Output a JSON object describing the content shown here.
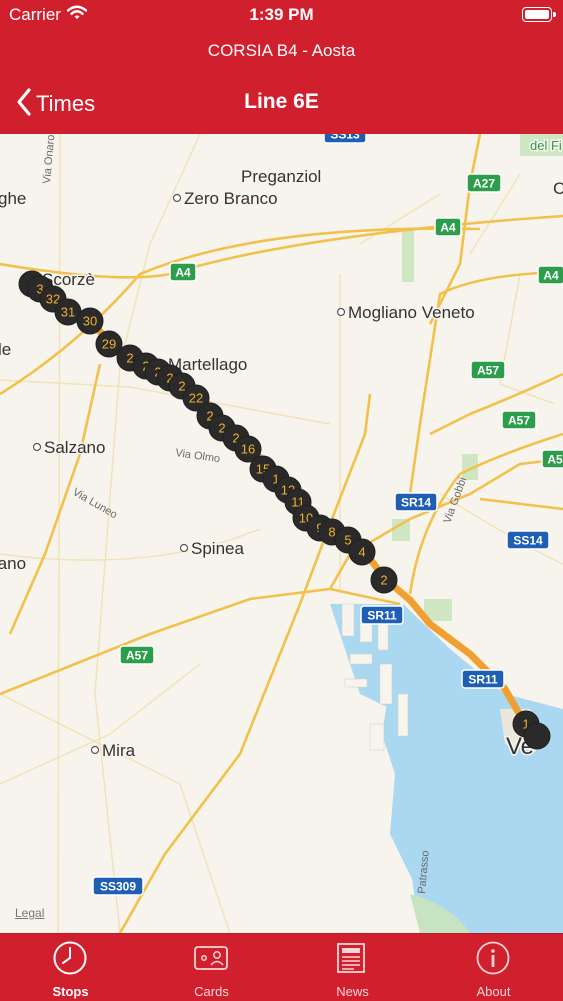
{
  "status_bar": {
    "carrier": "Carrier",
    "time": "1:39 PM"
  },
  "header": {
    "route": "CORSIA B4 - Aosta",
    "back_label": "Times",
    "title": "Line 6E"
  },
  "colors": {
    "brand": "#d0202e",
    "route": "#f0a030",
    "stop": "#2a2a2a",
    "stop_number": "#f0b030"
  },
  "map": {
    "legal": "Legal",
    "places": [
      {
        "name": "Preganziol",
        "dot": false
      },
      {
        "name": "Zero Branco",
        "dot": true
      },
      {
        "name": "Scorzè",
        "dot": false
      },
      {
        "name": "Mogliano Veneto",
        "dot": true
      },
      {
        "name": "Martellago",
        "dot": false
      },
      {
        "name": "Salzano",
        "dot": true
      },
      {
        "name": "Spinea",
        "dot": true
      },
      {
        "name": "Mira",
        "dot": true
      },
      {
        "name": "ghe",
        "dot": false
      },
      {
        "name": "le",
        "dot": false
      },
      {
        "name": "rano",
        "dot": false
      },
      {
        "name": "Ve",
        "dot": false
      },
      {
        "name": "del Fi",
        "dot": false
      },
      {
        "name": "C",
        "dot": false
      }
    ],
    "streets": [
      "Via Onaro",
      "Via Olmo",
      "Via Luneo",
      "Via Gobbi",
      "Patrasso"
    ],
    "shields": [
      {
        "label": "SS13",
        "style": "blue"
      },
      {
        "label": "A27",
        "style": "green"
      },
      {
        "label": "A4",
        "style": "green"
      },
      {
        "label": "A4",
        "style": "green"
      },
      {
        "label": "A4",
        "style": "green"
      },
      {
        "label": "A57",
        "style": "green"
      },
      {
        "label": "A57",
        "style": "green"
      },
      {
        "label": "A5",
        "style": "green"
      },
      {
        "label": "SR14",
        "style": "blue"
      },
      {
        "label": "SS14",
        "style": "blue"
      },
      {
        "label": "SR11",
        "style": "blue"
      },
      {
        "label": "SR11",
        "style": "blue"
      },
      {
        "label": "A57",
        "style": "green"
      },
      {
        "label": "SS309",
        "style": "blue"
      }
    ],
    "stops": [
      "3",
      "3",
      "32",
      "31",
      "30",
      "29",
      "2",
      "2",
      "2",
      "2",
      "2",
      "22",
      "2",
      "2",
      "2",
      "16",
      "15",
      "1",
      "12",
      "11",
      "10",
      "9",
      "8",
      "5",
      "4",
      "2",
      "1",
      ""
    ]
  },
  "tabs": [
    {
      "label": "Stops",
      "icon": "clock-icon",
      "selected": true
    },
    {
      "label": "Cards",
      "icon": "card-icon",
      "selected": false
    },
    {
      "label": "News",
      "icon": "newspaper-icon",
      "selected": false
    },
    {
      "label": "About",
      "icon": "info-icon",
      "selected": false
    }
  ]
}
